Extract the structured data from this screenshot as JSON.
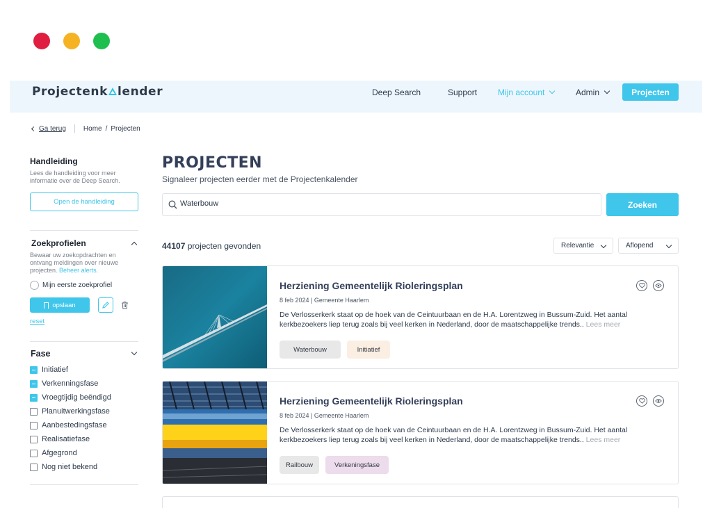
{
  "window": {
    "controls": [
      "close",
      "minimize",
      "maximize"
    ]
  },
  "header": {
    "logo_left": "Projectenk",
    "logo_right": "lender",
    "nav": {
      "deep_search": "Deep Search",
      "support": "Support",
      "my_account": "Mijn account",
      "admin": "Admin",
      "projects_button": "Projecten"
    },
    "accent_color": "#3fc6ea"
  },
  "breadcrumb": {
    "back": "Ga terug",
    "home": "Home",
    "separator": "/",
    "current": "Projecten"
  },
  "sidebar": {
    "manual": {
      "title": "Handleiding",
      "description": "Lees de handleiding voor meer informatie over de Deep Search.",
      "button": "Open de handleiding"
    },
    "profiles": {
      "title": "Zoekprofielen",
      "description": "Bewaar uw zoekopdrachten en ontvang meldingen over nieuwe projecten.",
      "link": "Beheer alerts.",
      "profile_name": "Mijn eerste zoekprofiel",
      "save_button": "opslaan",
      "reset": "reset"
    },
    "phase": {
      "title": "Fase",
      "options": [
        {
          "label": "Initiatief",
          "checked": true
        },
        {
          "label": "Verkenningsfase",
          "checked": true
        },
        {
          "label": "Vroegtijdig beëndigd",
          "checked": true
        },
        {
          "label": "Planuitwerkingsfase",
          "checked": false
        },
        {
          "label": "Aanbestedingsfase",
          "checked": false
        },
        {
          "label": "Realisatiefase",
          "checked": false
        },
        {
          "label": "Afgegrond",
          "checked": false
        },
        {
          "label": "Nog niet bekend",
          "checked": false
        }
      ]
    }
  },
  "main": {
    "title": "PROJECTEN",
    "subtitle": "Signaleer projecten eerder met de Projectenkalender",
    "search": {
      "value": "Waterbouw",
      "button": "Zoeken"
    },
    "results": {
      "count": "44107",
      "label": "projecten gevonden"
    },
    "sort": {
      "relevance": "Relevantie",
      "order": "Aflopend"
    },
    "cards": [
      {
        "title": "Herziening Gemeentelijk Rioleringsplan",
        "date": "8 feb 2024",
        "org": "Gemeente Haarlem",
        "text": "De Verlosserkerk staat op de hoek van de Ceintuurbaan en de H.A. Lorentzweg in Bussum-Zuid. Het aantal kerkbezoekers liep terug zoals bij veel kerken in Nederland, door de  maatschappelijke trends..",
        "read_more": "Lees meer",
        "tags": [
          {
            "label": "Waterbouw",
            "bg": "#e8e8e8"
          },
          {
            "label": "Initiatief",
            "bg": "#fbeee2"
          }
        ],
        "image": "bridge-over-water"
      },
      {
        "title": "Herziening Gemeentelijk Rioleringsplan",
        "date": "8 feb 2024",
        "org": "Gemeente Haarlem",
        "text": "De Verlosserkerk staat op de hoek van de Ceintuurbaan en de H.A. Lorentzweg in Bussum-Zuid. Het aantal kerkbezoekers liep terug zoals bij veel kerken in Nederland, door de  maatschappelijke trends..",
        "read_more": "Lees meer",
        "tags": [
          {
            "label": "Railbouw",
            "bg": "#e8e8e8"
          },
          {
            "label": "Verkeningsfase",
            "bg": "#ecdcec"
          }
        ],
        "image": "train-in-station"
      }
    ]
  }
}
